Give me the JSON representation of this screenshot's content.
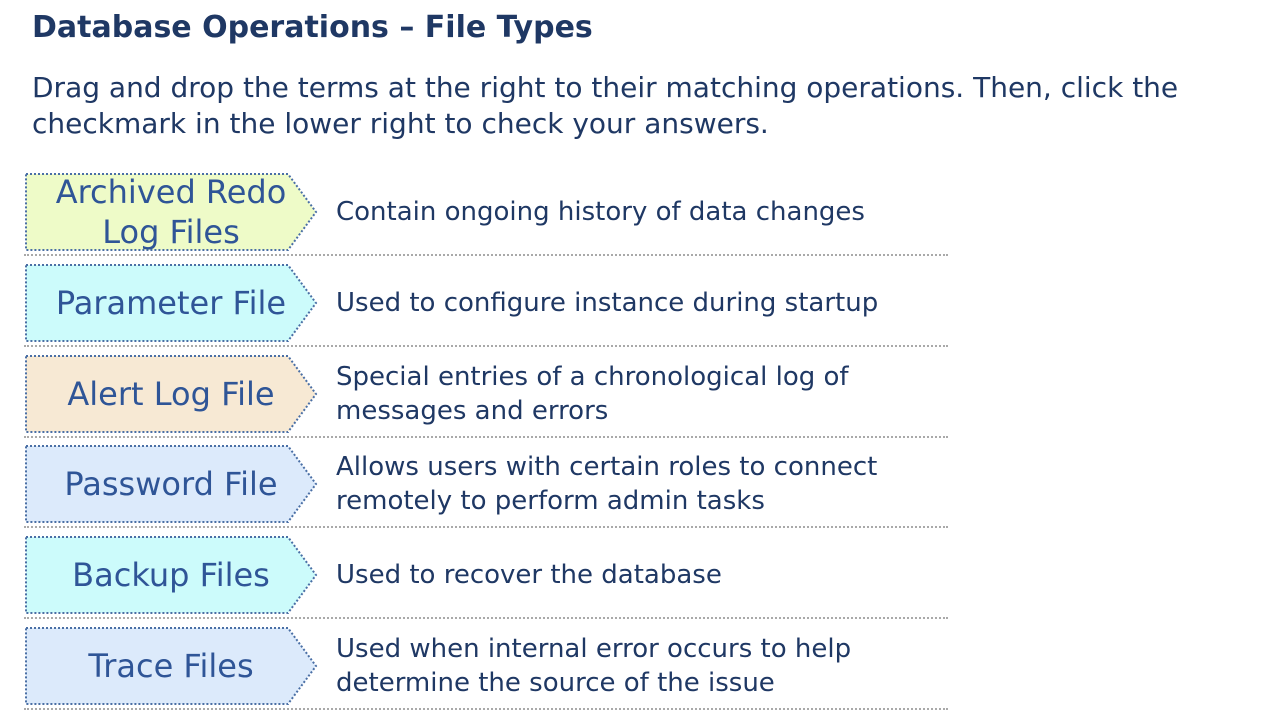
{
  "page": {
    "title": "Database Operations – File Types",
    "instructions": "Drag and drop the terms at the right to their matching operations. Then, click the checkmark in the lower right to check your answers."
  },
  "rows": [
    {
      "term": "Archived Redo Log Files",
      "description": "Contain ongoing history of data changes",
      "fill": "#eefbc8"
    },
    {
      "term": "Parameter File",
      "description": "Used to configure instance during startup",
      "fill": "#ccfbfb"
    },
    {
      "term": "Alert Log File",
      "description": "Special entries of a chronological log of messages and errors",
      "fill": "#f7e9d4"
    },
    {
      "term": "Password File",
      "description": "Allows users with certain roles to connect remotely to perform admin tasks",
      "fill": "#dceafb"
    },
    {
      "term": "Backup Files",
      "description": "Used to recover the database",
      "fill": "#ccfbfb"
    },
    {
      "term": "Trace Files",
      "description": "Used when internal error occurs to help determine the source of the issue",
      "fill": "#dceafb"
    }
  ],
  "colors": {
    "title": "#1f3864",
    "term_text": "#2f5597",
    "term_border": "#4a6fa5",
    "divider": "#a9a9a9"
  },
  "icons": {
    "term_shape": "chevron-tag-shape"
  }
}
